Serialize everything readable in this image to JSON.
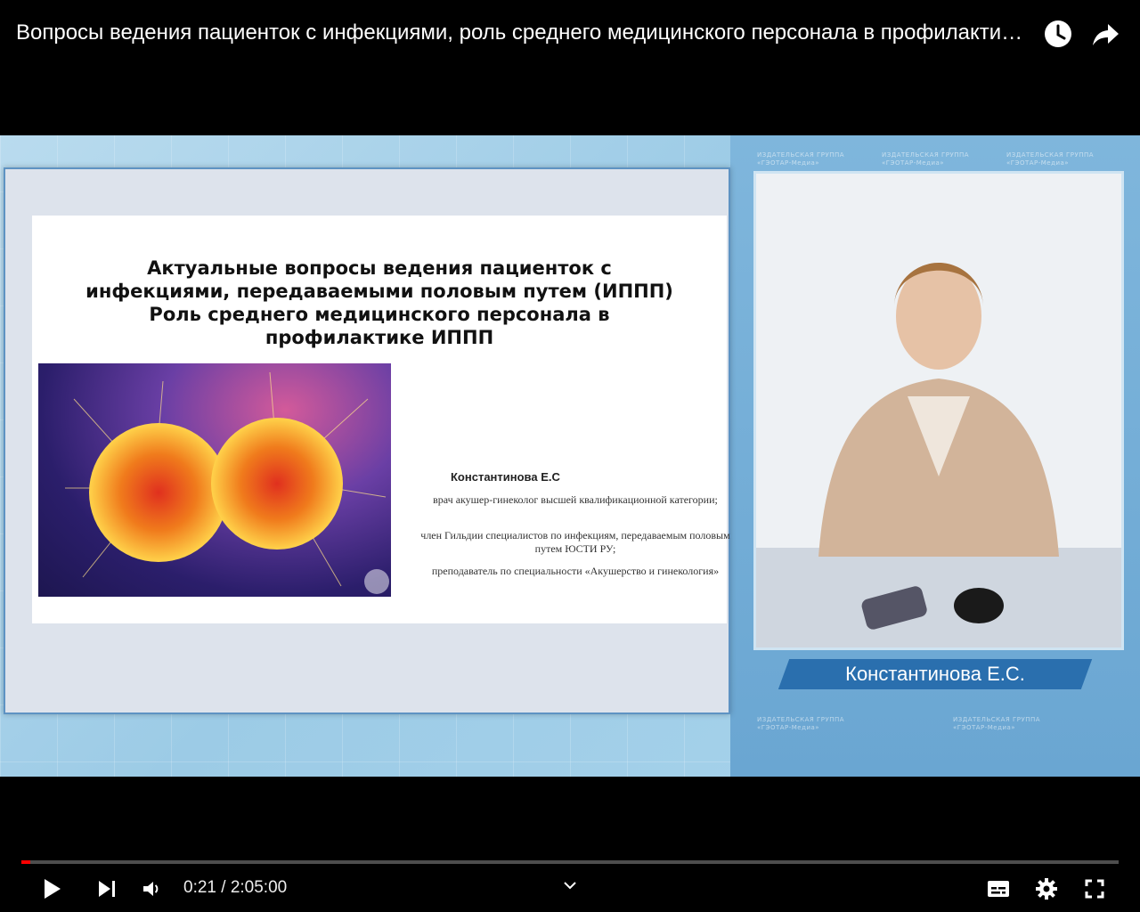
{
  "video": {
    "title": "Вопросы ведения пациенток с инфекциями, роль среднего медицинского персонала в профилактике ИППП"
  },
  "slide": {
    "title_lines": [
      "Актуальные вопросы ведения пациенток с",
      "инфекциями, передаваемыми половым путем (ИППП)",
      "Роль среднего медицинского персонала в",
      "профилактике ИППП"
    ],
    "author": "Константинова Е.С",
    "author_details": [
      "врач акушер-гинеколог высшей квалификационной категории;",
      "член Гильдии специалистов по инфекциям, передаваемым половым путем ЮСТИ РУ;",
      "преподаватель по специальности «Акушерство и гинекология»"
    ]
  },
  "speaker": {
    "name_caption": "Константинова Е.С."
  },
  "watermark": {
    "publisher": "ИЗДАТЕЛЬСКАЯ ГРУППА",
    "brand": "«ГЭОТАР-Медиа»"
  },
  "player": {
    "current_time": "0:21",
    "separator": "/",
    "duration": "2:05:00",
    "progress_fraction": 0.0028
  },
  "icons": {
    "top": [
      "watch-later-icon",
      "share-icon"
    ],
    "controls": [
      "play-icon",
      "next-icon",
      "volume-icon",
      "chevron-down-icon",
      "subtitles-icon",
      "settings-icon",
      "fullscreen-icon"
    ]
  },
  "colors": {
    "progress": "#ff0000",
    "banner": "#2a6fae"
  }
}
